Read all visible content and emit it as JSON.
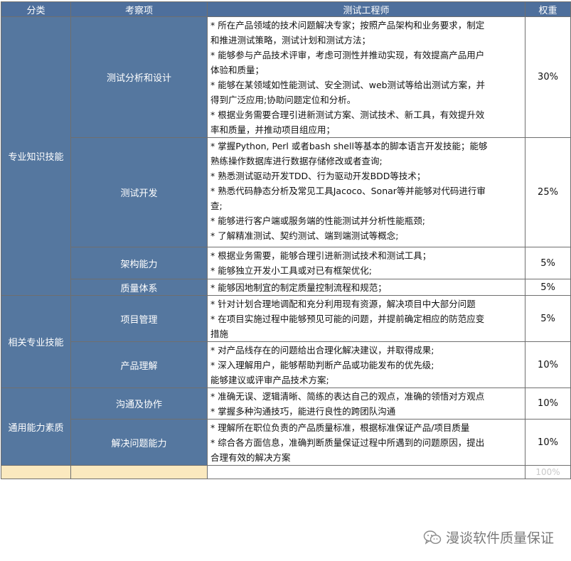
{
  "header": {
    "category": "分类",
    "item": "考察项",
    "description": "测试工程师",
    "weight": "权重"
  },
  "groups": [
    {
      "name": "专业知识技能"
    },
    {
      "name": "相关专业技能"
    },
    {
      "name": "通用能力素质"
    }
  ],
  "rows": [
    {
      "item": "测试分析和设计",
      "weight": "30%",
      "lines": [
        "* 所在产品领域的技术问题解决专家；按照产品架构和业务要求，制定",
        "和推进测试策略，测试计划和测试方法；",
        "* 能够参与产品技术评审，考虑可测性并推动实现，有效提高产品用户",
        "体验和质量；",
        "* 能够在某领域如性能测试、安全测试、web测试等给出测试方案，并",
        "得到广泛应用;协助问题定位和分析。",
        "* 根据业务需要合理引进新测试方案、测试技术、新工具，有效提升效",
        "率和质量，并推动项目组应用；"
      ]
    },
    {
      "item": "测试开发",
      "weight": "25%",
      "lines": [
        "* 掌握Python, Perl 或者bash shell等基本的脚本语言开发技能；能够",
        "熟练操作数据库进行数据存储修改或者查询;",
        "* 熟悉测试驱动开发TDD、行为驱动开发BDD等技术；",
        "* 熟悉代码静态分析及常见工具Jacoco、Sonar等并能够对代码进行审",
        "查;",
        "* 能够进行客户端或服务端的性能测试并分析性能瓶颈;",
        "* 了解精准测试、契约测试、端到端测试等概念;"
      ]
    },
    {
      "item": "架构能力",
      "weight": "5%",
      "lines": [
        "* 根据业务需要，能够合理引进新测试技术和测试工具；",
        "* 能够独立开发小工具或对已有框架优化;"
      ]
    },
    {
      "item": "质量体系",
      "weight": "5%",
      "lines": [
        "* 能够因地制宜的制定质量控制流程和规范；"
      ]
    },
    {
      "item": "项目管理",
      "weight": "5%",
      "lines": [
        "* 针对计划合理地调配和充分利用现有资源，解决项目中大部分问题",
        "* 在项目实施过程中能够预见可能的问题，并提前确定相应的防范应变",
        "措施"
      ]
    },
    {
      "item": "产品理解",
      "weight": "10%",
      "lines": [
        "* 对产品线存在的问题给出合理化解决建议，并取得成果;",
        "* 深入理解用户，能够帮助判断产品或功能发布的优先级;",
        "能够建议或评审产品技术方案;"
      ]
    },
    {
      "item": "沟通及协作",
      "weight": "10%",
      "lines": [
        "* 准确无误、逻辑清晰、简练的表达自己的观点，准确的领悟对方观点",
        "* 掌握多种沟通技巧，能进行良性的跨团队沟通"
      ]
    },
    {
      "item": "解决问题能力",
      "weight": "10%",
      "lines": [
        "* 理解所在职位负责的产品质量标准，根据标准保证产品/项目质量",
        "* 综合各方面信息，准确判断质量保证过程中所遇到的问题原因，提出",
        "合理有效的解决方案"
      ]
    }
  ],
  "total": {
    "weight": "100%"
  },
  "watermark": {
    "text": "漫谈软件质量保证",
    "icon": "wechat-icon"
  }
}
